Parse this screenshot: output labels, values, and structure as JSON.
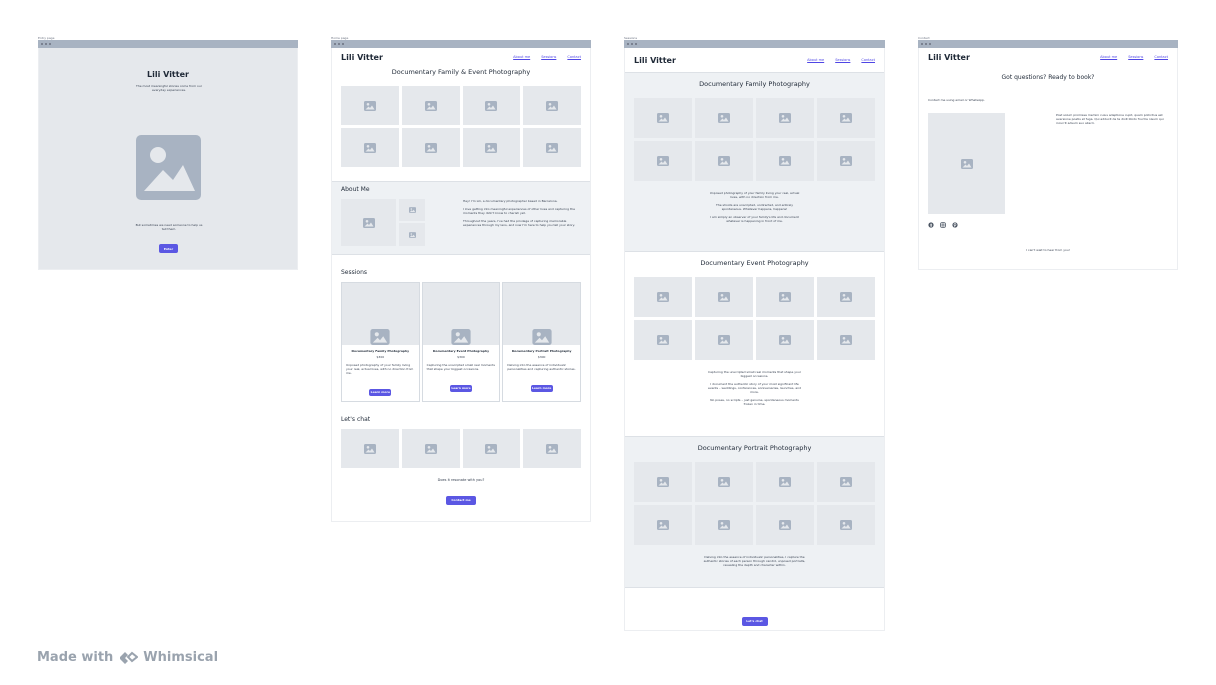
{
  "brand": "Lili Vitter",
  "nav": {
    "about": "About me",
    "sessions": "Sessions",
    "contact": "Contact"
  },
  "frame1": {
    "label": "Entry page",
    "title": "Lili Vitter",
    "tagline": "The most meaningful stories come from our everyday experiences.",
    "subtext": "But sometimes we need someone to help us tell them.",
    "button": "Enter"
  },
  "frame2": {
    "label": "Home page",
    "hero_title": "Documentary Family & Event Photography",
    "about_title": "About Me",
    "about_p1": "Hey! I'm Lili, a documentary photographer based in Barcelona.",
    "about_p2": "I love getting into meaningful experiences of other lives and capturing the moments they didn't know to cherish yet.",
    "about_p3": "Throughout the years, I've had the privilege of capturing memorable experiences through my lens, and now I'm here to help you tell your story.",
    "sessions_title": "Sessions",
    "sessions": [
      {
        "title": "Documentary Family Photography",
        "price": "$300",
        "desc": "Unposed photography of your family living your real, actual lives, with no direction from me.",
        "button": "Learn more"
      },
      {
        "title": "Documentary Event Photography",
        "price": "$300",
        "desc": "Capturing the unscripted small real moments that shape your biggest occasions.",
        "button": "Learn more"
      },
      {
        "title": "Documentary Portrait Photography",
        "price": "$300",
        "desc": "Delving into the essence of individuals' personalities and capturing authentic stories.",
        "button": "Learn more"
      }
    ],
    "chat_title": "Let's chat",
    "resonate": "Does it resonate with you?",
    "contact_button": "Contact me"
  },
  "frame3": {
    "label": "Sessions",
    "family_title": "Documentary Family Photography",
    "family_p1": "Unposed photography of your family living your real, actual lives, with no direction from me.",
    "family_p2": "The shoots are unscripted, undirected, and entirely spontaneous. Whatever happens, happens!",
    "family_p3": "I am simply an observer of your family's life and document whatever is happening in front of me.",
    "event_title": "Documentary Event Photography",
    "event_p1": "Capturing the unscripted small real moments that shape your biggest occasions.",
    "event_p2": "I document the authentic story of your most significant life events – weddings, conferences, anniversaries, launches, and more.",
    "event_p3": "No poses, no scripts – just genuine, spontaneous moments frozen in time.",
    "portrait_title": "Documentary Portrait Photography",
    "portrait_p1": "Delving into the essence of individuals' personalities, I capture the authentic stories of each person through candid, unposed portraits, revealing the depth and character within.",
    "button": "Let's chat"
  },
  "frame4": {
    "label": "Contact",
    "title": "Got questions? Ready to book?",
    "contact_line": "Contact me using email or WhatsApp.",
    "latin": "Post solum promissa memini cuius adeptione cupit, quam pollicitus est aversione poetis et fuga. Qui adducit de te dixit libido fructra nisum qui incurrit adsum suo abscli.",
    "closing": "I can't wait to hear from you!"
  },
  "footer": {
    "made_with": "Made with",
    "product": "Whimsical"
  },
  "colors": {
    "accent": "#5b57e3",
    "placeholder": "#e5e8ec",
    "icon": "#a8b3c2"
  }
}
